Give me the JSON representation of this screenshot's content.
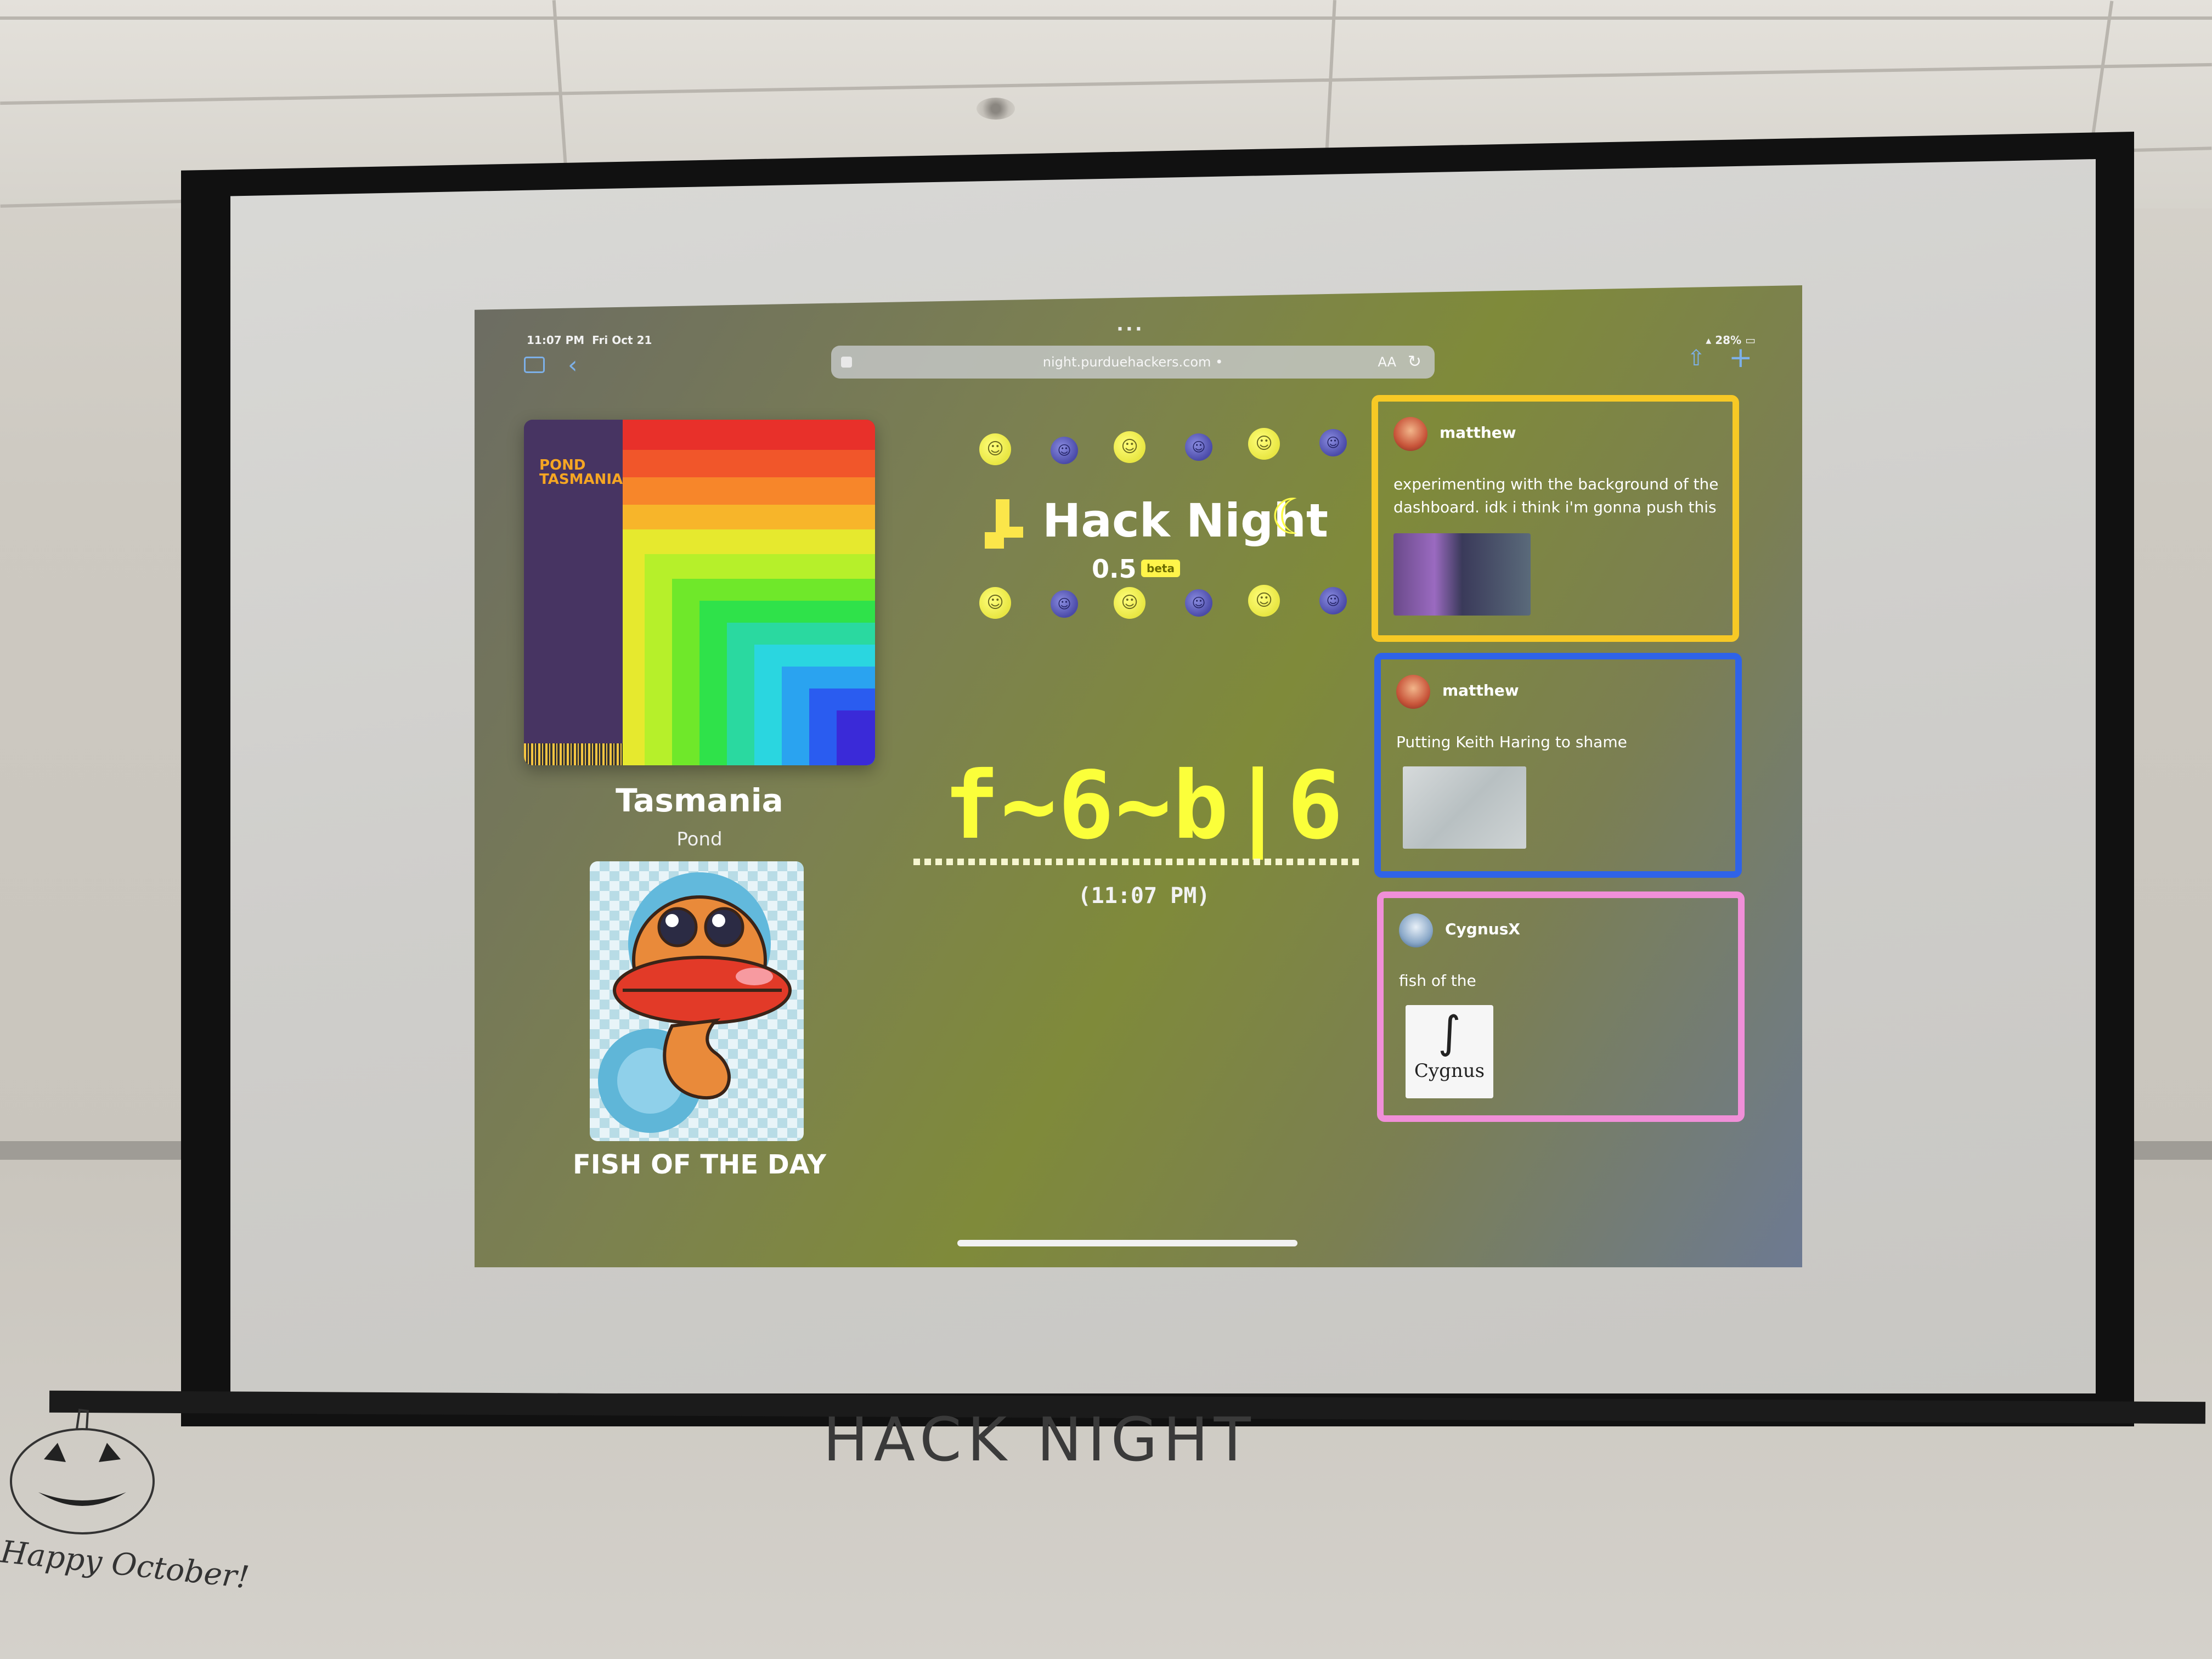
{
  "status_bar": {
    "time": "11:07 PM",
    "date": "Fri Oct 21",
    "battery": "28%"
  },
  "browser": {
    "url": "night.purduehackers.com",
    "text_size_label": "AA"
  },
  "now_playing": {
    "album_cover_title": "POND\nTASMANIA",
    "track": "Tasmania",
    "artist": "Pond"
  },
  "fish": {
    "caption": "FISH OF THE DAY"
  },
  "brand": {
    "title": "Hack Night",
    "version": "0.5",
    "badge": "beta"
  },
  "clock": {
    "encoded_time": "f~6~b|6",
    "readable_time": "(11:07 PM)"
  },
  "posts": [
    {
      "user": "matthew",
      "text": "experimenting with the background of the dashboard. idk i think i'm gonna push this",
      "border_color": "#f7c925"
    },
    {
      "user": "matthew",
      "text": "Putting Keith Haring to shame",
      "border_color": "#2f63e8"
    },
    {
      "user": "CygnusX",
      "text": "fish of the",
      "image_label": "Cygnus",
      "border_color": "#f08fd8"
    }
  ],
  "wall": {
    "greeting": "Happy October!",
    "scrawl": "HACK NIGHT"
  },
  "icons": [
    "sidebar-icon",
    "back-icon",
    "reload-icon",
    "share-icon",
    "plus-icon",
    "moon-icon",
    "lock-icon"
  ]
}
